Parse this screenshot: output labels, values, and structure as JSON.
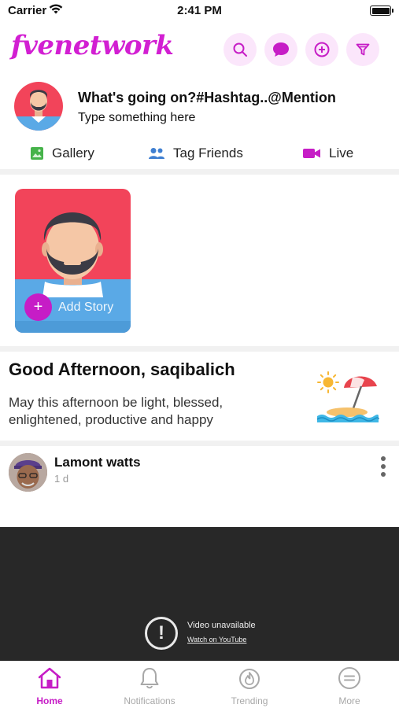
{
  "status_bar": {
    "carrier": "Carrier",
    "time": "2:41 PM"
  },
  "header": {
    "logo": "fvenetwork",
    "brand_color": "#d21fd2",
    "buttons": [
      "search-icon",
      "chat-icon",
      "add-circle-icon",
      "filter-icon"
    ]
  },
  "composer": {
    "prompt": "What's going on?#Hashtag..@Mention",
    "hint": "Type something here",
    "actions": [
      {
        "label": "Gallery",
        "icon": "gallery-icon",
        "color": "#46b34a"
      },
      {
        "label": "Tag Friends",
        "icon": "people-icon",
        "color": "#3f7fd1"
      },
      {
        "label": "Live",
        "icon": "video-camera-icon",
        "color": "#c61dc6"
      }
    ]
  },
  "story": {
    "add_label": "Add Story",
    "plus": "+"
  },
  "greeting": {
    "title": "Good Afternoon, saqibalich",
    "message": "May this afternoon be light, blessed, enlightened, productive and happy"
  },
  "post": {
    "author": "Lamont watts",
    "time": "1 d"
  },
  "video": {
    "alert": "!",
    "message": "Video unavailable",
    "link": "Watch on YouTube"
  },
  "tabs": [
    {
      "label": "Home",
      "icon": "home-icon",
      "active": true
    },
    {
      "label": "Notifications",
      "icon": "bell-icon",
      "active": false
    },
    {
      "label": "Trending",
      "icon": "flame-icon",
      "active": false
    },
    {
      "label": "More",
      "icon": "menu-icon",
      "active": false
    }
  ]
}
